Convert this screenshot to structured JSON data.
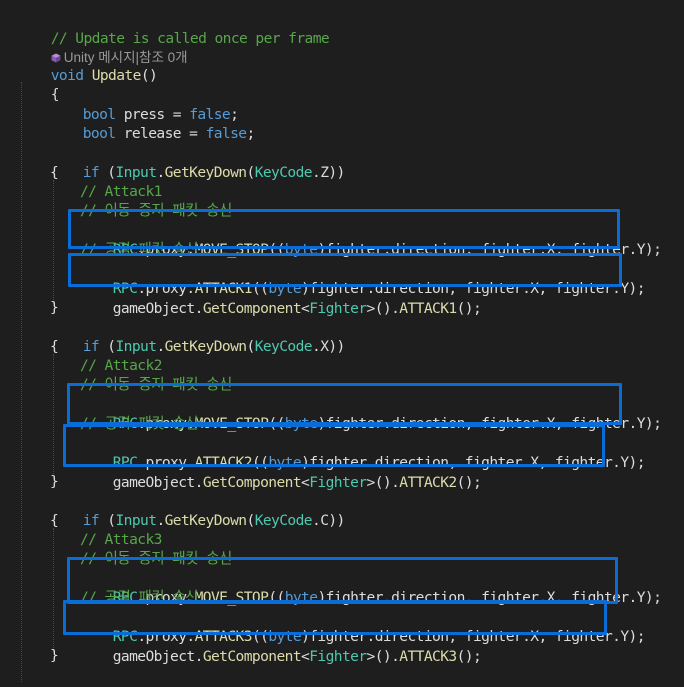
{
  "editor": {
    "colors": {
      "background": "#1e1e1e",
      "comment": "#57a64a",
      "keyword": "#569cd6",
      "type": "#4ec9b0",
      "method": "#dcdcaa",
      "text": "#dcdcdc",
      "highlight_box": "#0a6cd6"
    },
    "lens_icon": "unity-cube-icon",
    "lines": {
      "l1": {
        "comment": "// Update is called once per frame"
      },
      "l2": {
        "lens": "Unity 메시지|참조 0개"
      },
      "l3": {
        "kw": "void",
        "name": "Update",
        "paren": "()"
      },
      "l4": {
        "brace": "{"
      },
      "l5": {
        "kw": "bool",
        "var": "press",
        "eq": " = ",
        "val": "false",
        "end": ";"
      },
      "l6": {
        "kw": "bool",
        "var": "release",
        "eq": " = ",
        "val": "false",
        "end": ";"
      },
      "blocks": [
        {
          "if": "if",
          "open": " (",
          "cls": "Input",
          "dot": ".",
          "method": "GetKeyDown",
          "arg_open": "(",
          "arg_type": "KeyCode",
          "arg_dot": ".",
          "arg_key": "Z",
          "close": "))",
          "brace_open": "{",
          "comment_attack": "// Attack1",
          "comment_stop": "// 이동 중지 패킷 송신",
          "stop_line": {
            "cls": "RPC",
            "a": ".proxy.",
            "m": "MOVE_STOP",
            "p1": "((",
            "kw": "byte",
            "rest": ")fighter.direction, fighter.X, fighter.Y);"
          },
          "comment_attack_send": "// 공격 패킷 송신",
          "attack_line": {
            "cls": "RPC",
            "a": ".proxy.",
            "m": "ATTACK1",
            "p1": "((",
            "kw": "byte",
            "rest": ")fighter.direction, fighter.X, fighter.Y);"
          },
          "component_line": {
            "a": "gameObject.",
            "m": "GetComponent",
            "lt": "<",
            "t": "Fighter",
            "gt": ">().",
            "m2": "ATTACK1",
            "end": "();"
          },
          "brace_close": "}"
        },
        {
          "if": "if",
          "open": " (",
          "cls": "Input",
          "dot": ".",
          "method": "GetKeyDown",
          "arg_open": "(",
          "arg_type": "KeyCode",
          "arg_dot": ".",
          "arg_key": "X",
          "close": "))",
          "brace_open": "{",
          "comment_attack": "// Attack2",
          "comment_stop": "// 이동 중지 패킷 송신",
          "stop_line": {
            "cls": "RPC",
            "a": ".proxy.",
            "m": "MOVE_STOP",
            "p1": "((",
            "kw": "byte",
            "rest": ")fighter.direction, fighter.X, fighter.Y);"
          },
          "comment_attack_send": "// 공격 패킷 송신",
          "attack_line": {
            "cls": "RPC",
            "a": ".proxy.",
            "m": "ATTACK2",
            "p1": "((",
            "kw": "byte",
            "rest": ")fighter.direction, fighter.X, fighter.Y);"
          },
          "component_line": {
            "a": "gameObject.",
            "m": "GetComponent",
            "lt": "<",
            "t": "Fighter",
            "gt": ">().",
            "m2": "ATTACK2",
            "end": "();"
          },
          "brace_close": "}"
        },
        {
          "if": "if",
          "open": " (",
          "cls": "Input",
          "dot": ".",
          "method": "GetKeyDown",
          "arg_open": "(",
          "arg_type": "KeyCode",
          "arg_dot": ".",
          "arg_key": "C",
          "close": "))",
          "brace_open": "{",
          "comment_attack": "// Attack3",
          "comment_stop": "// 이동 중지 패킷 송신",
          "stop_line": {
            "cls": "RPC",
            "a": ".proxy.",
            "m": "MOVE_STOP",
            "p1": "((",
            "kw": "byte",
            "rest": ")fighter.direction, fighter.X, fighter.Y);"
          },
          "comment_attack_send": "// 공격 패킷 송신",
          "attack_line": {
            "cls": "RPC",
            "a": ".proxy.",
            "m": "ATTACK3",
            "p1": "((",
            "kw": "byte",
            "rest": ")fighter.direction, fighter.X, fighter.Y);"
          },
          "component_line": {
            "a": "gameObject.",
            "m": "GetComponent",
            "lt": "<",
            "t": "Fighter",
            "gt": ">().",
            "m2": "ATTACK3",
            "end": "();"
          },
          "brace_close": "}"
        }
      ]
    }
  }
}
